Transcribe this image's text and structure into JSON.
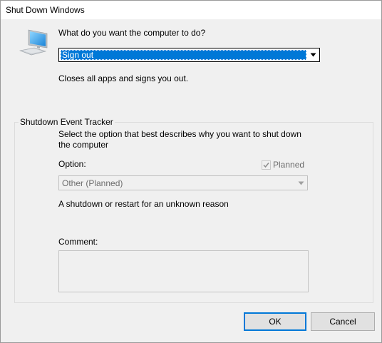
{
  "window": {
    "title": "Shut Down Windows"
  },
  "action": {
    "prompt": "What do you want the computer to do?",
    "selected": "Sign out",
    "description": "Closes all apps and signs you out."
  },
  "tracker": {
    "group_label": "Shutdown Event Tracker",
    "instructions_line1": "Select the option that best describes why you want to shut down",
    "instructions_line2": "the computer",
    "option_label": "Option:",
    "planned_label": "Planned",
    "planned_checked": true,
    "option_selected": "Other (Planned)",
    "reason_description": "A shutdown or restart for an unknown reason",
    "comment_label": "Comment:",
    "comment_value": ""
  },
  "buttons": {
    "ok_label": "OK",
    "cancel_label": "Cancel"
  },
  "icons": {
    "computer": "computer-monitor-icon",
    "dropdown": "chevron-down-icon",
    "check": "checkmark-icon"
  },
  "colors": {
    "selection": "#0078d7",
    "dialog_bg": "#f0f0f0",
    "disabled_text": "#6d6d6d"
  }
}
